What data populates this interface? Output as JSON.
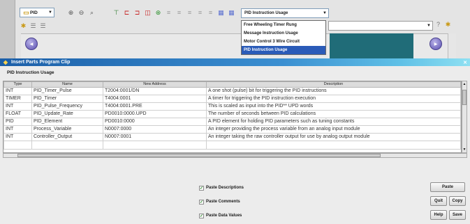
{
  "toolbar": {
    "selector_value": "PID",
    "instruction_combo_value": "PID Instruction Usage",
    "dropdown_options": [
      "Free Wheeling Timer Rung",
      "Message Instruction Usage",
      "Motor Control 3 Wire Circuit",
      "PID Instruction Usage"
    ]
  },
  "dialog": {
    "title": "Insert Parts Program Clip",
    "section_label": "PID Instruction Usage",
    "columns": [
      "Type",
      "Name",
      "New Address",
      "Description"
    ],
    "rows": [
      [
        "INT",
        "PID_Timer_Pulse",
        "T2004:0001/DN",
        "A one shot (pulse) bit for triggering the PID instructions"
      ],
      [
        "TIMER",
        "PID_Timer",
        "T4004:0001",
        "A timer for triggering the PID instruction execution"
      ],
      [
        "INT",
        "PID_Pulse_Frequency",
        "T4004:0001.PRE",
        "This is scaled as input into the PID** UPD words"
      ],
      [
        "FLOAT",
        "PID_Update_Rate",
        "PD0010:0000.UPD",
        "The number of seconds between PID calculations"
      ],
      [
        "PID",
        "PID_Element",
        "PD0010:0000",
        "A PID element for holding PID parameters such as tuning constants"
      ],
      [
        "INT",
        "Process_Variable",
        "N0007:0000",
        "An integer providing the process variable from an analog input module"
      ],
      [
        "INT",
        "Controller_Output",
        "N0007:0001",
        "An integer taking the raw controller output for use by analog output module"
      ]
    ],
    "checkboxes": [
      {
        "label": "Paste Descriptions",
        "checked": true
      },
      {
        "label": "Paste Comments",
        "checked": true
      },
      {
        "label": "Paste Data Values",
        "checked": true
      }
    ],
    "buttons": {
      "paste": "Paste",
      "quit": "Quit",
      "copy": "Copy",
      "help": "Help",
      "save": "Save"
    }
  },
  "colors": {
    "title_bar_start": "#1c5fa8",
    "title_bar_end": "#8fe0f2",
    "canvas_teal": "#206c78",
    "dropdown_selected": "#2a5bb8"
  },
  "icons": [
    "folder-icon",
    "zoom-in-icon",
    "zoom-out-icon",
    "zoom-fit-icon",
    "ladder-icon",
    "contact-icon",
    "coil-icon",
    "branch-icon",
    "network-icon",
    "settings-icon",
    "close-icon"
  ]
}
